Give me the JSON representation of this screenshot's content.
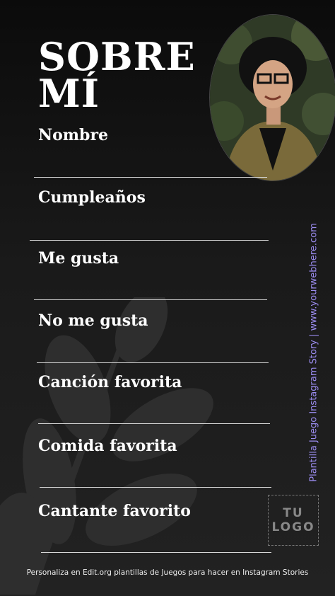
{
  "title": {
    "line1": "SOBRE",
    "line2": "MÍ"
  },
  "fields": [
    {
      "label": "Nombre"
    },
    {
      "label": "Cumpleaños"
    },
    {
      "label": "Me gusta"
    },
    {
      "label": "No me gusta"
    },
    {
      "label": "Canción favorita"
    },
    {
      "label": "Comida favorita"
    },
    {
      "label": "Cantante favorito"
    }
  ],
  "side_text": "Plantilla Juego Instagram Story | www.yourwebhere.com",
  "logo": {
    "line1": "TU",
    "line2": "LOGO"
  },
  "footer": "Personaliza en Edit.org plantillas de Juegos para hacer en Instagram Stories",
  "colors": {
    "background": "#1c1c1c",
    "accent_text": "#9b8cf0",
    "line": "#d8d8d8"
  }
}
